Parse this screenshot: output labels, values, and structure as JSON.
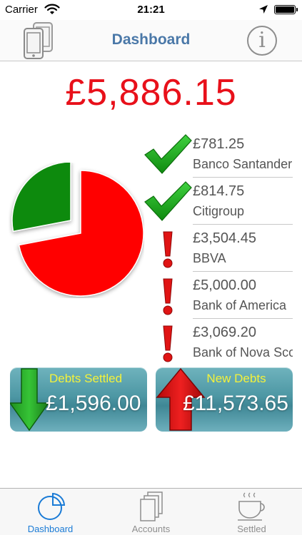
{
  "status_bar": {
    "carrier": "Carrier",
    "time": "21:21"
  },
  "nav": {
    "title": "Dashboard"
  },
  "total": "£5,886.15",
  "pie": {
    "settled_fraction": 0.28,
    "settled_color": "#118a11",
    "outstanding_color": "#ff0000"
  },
  "accounts": [
    {
      "amount": "£781.25",
      "name": "Banco Santander",
      "status": "settled"
    },
    {
      "amount": "£814.75",
      "name": "Citigroup",
      "status": "settled"
    },
    {
      "amount": "£3,504.45",
      "name": "BBVA",
      "status": "outstanding"
    },
    {
      "amount": "£5,000.00",
      "name": "Bank of America",
      "status": "outstanding"
    },
    {
      "amount": "£3,069.20",
      "name": "Bank of Nova Scotia",
      "status": "outstanding"
    }
  ],
  "summary": {
    "settled_label": "Debts Settled",
    "settled_value": "£1,596.00",
    "new_label": "New Debts",
    "new_value": "£11,573.65"
  },
  "tabs": [
    {
      "label": "Dashboard",
      "icon": "pie-chart-icon",
      "active": true
    },
    {
      "label": "Accounts",
      "icon": "stacked-pages-icon",
      "active": false
    },
    {
      "label": "Settled",
      "icon": "coffee-cup-icon",
      "active": false
    }
  ],
  "colors": {
    "accent": "#1a7bd6",
    "title": "#4a78a8",
    "total": "#e8101a",
    "label_yellow": "#f4f23a"
  }
}
